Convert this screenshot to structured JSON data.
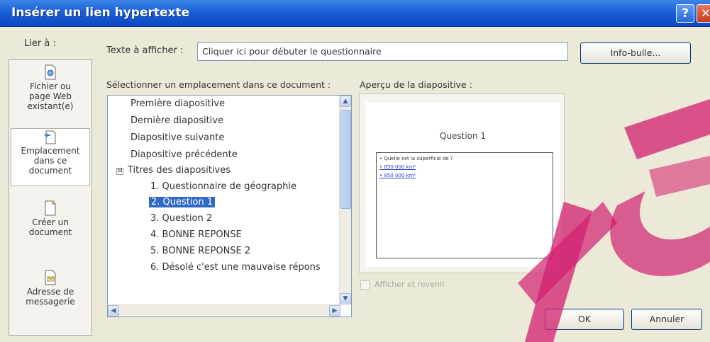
{
  "window": {
    "title": "Insérer un lien hypertexte",
    "help_label": "?",
    "close_label": "✕"
  },
  "link_to": {
    "label": "Lier à :",
    "items": [
      {
        "label_lines": [
          "Fichier ou",
          "page Web",
          "existant(e)"
        ],
        "icon": "web-page-icon",
        "active": false
      },
      {
        "label_lines": [
          "Emplacement",
          "dans ce",
          "document"
        ],
        "icon": "place-in-document-icon",
        "active": true
      },
      {
        "label_lines": [
          "Créer un",
          "document"
        ],
        "icon": "new-document-icon",
        "active": false
      },
      {
        "label_lines": [
          "Adresse de",
          "messagerie"
        ],
        "icon": "email-address-icon",
        "active": false
      }
    ]
  },
  "text_to_display": {
    "label": "Texte à afficher :",
    "value": "Cliquer ici pour débuter le questionnaire"
  },
  "screentip_button": "Info-bulle...",
  "select_place": {
    "label": "Sélectionner un emplacement dans ce document :",
    "items": [
      "Première diapositive",
      "Dernière diapositive",
      "Diapositive suivante",
      "Diapositive précédente",
      "Titres des diapositives",
      "1. Questionnaire de géographie",
      "2. Question 1",
      "3. Question 2",
      "4. BONNE REPONSE",
      "5. BONNE REPONSE 2",
      "6. Désolé c'est une mauvaise répons"
    ],
    "expander": "⊟",
    "selected_index": 6
  },
  "preview": {
    "label": "Aperçu de la diapositive :",
    "slide_title": "Question 1",
    "bullets": [
      "Quelle est la superficie de ?",
      "850 000 km²",
      "850 000 km²"
    ]
  },
  "show_and_return": {
    "label": "Afficher et revenir"
  },
  "buttons": {
    "ok": "OK",
    "cancel": "Annuler"
  },
  "colors": {
    "titlebar": "#1c5fd6",
    "selection": "#3169c6",
    "watermark": "#d21f6f"
  }
}
